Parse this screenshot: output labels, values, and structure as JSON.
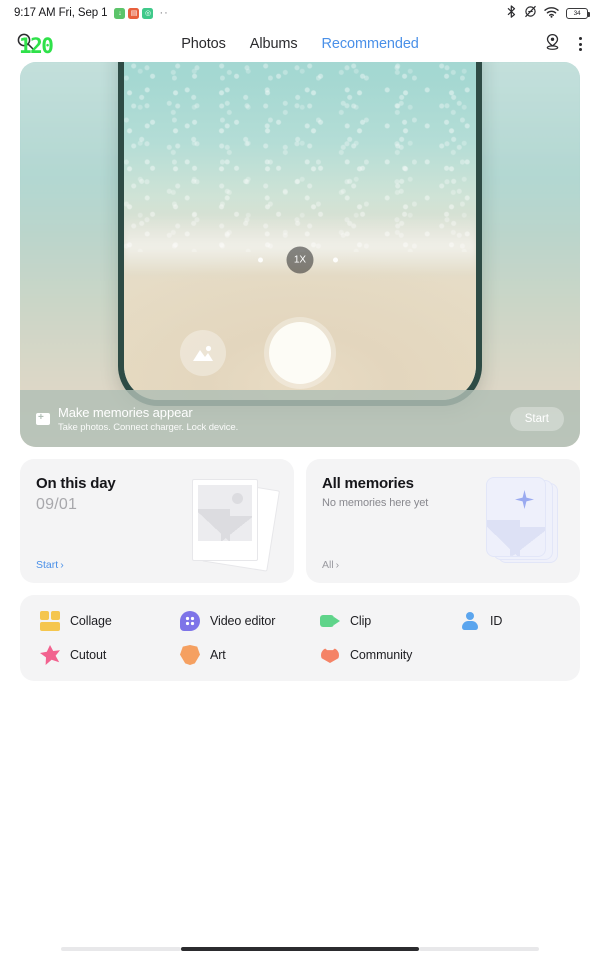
{
  "status_bar": {
    "time": "9:17 AM Fri, Sep 1",
    "app_icons": [
      {
        "name": "download-icon",
        "glyph": "↓",
        "color": "#5cc46a"
      },
      {
        "name": "notes-icon",
        "glyph": "▤",
        "color": "#e8603c"
      },
      {
        "name": "chat-icon",
        "glyph": "◎",
        "color": "#3fc98a"
      }
    ],
    "overflow_dots": "··",
    "bluetooth_icon": "bluetooth-icon",
    "dnd_icon": "do-not-disturb-icon",
    "wifi_icon": "wifi-icon",
    "battery_level": "34"
  },
  "header": {
    "search_icon": "search-icon",
    "fps_badge": "120",
    "tabs": [
      {
        "label": "Photos",
        "active": false
      },
      {
        "label": "Albums",
        "active": false
      },
      {
        "label": "Recommended",
        "active": true
      }
    ],
    "location_icon": "location-pin-icon",
    "more_icon": "more-vertical-icon"
  },
  "hero": {
    "camera_zoom_label": "1X",
    "gallery_icon": "gallery-thumbnail-icon",
    "shutter_icon": "shutter-button-icon",
    "flip_icon": "camera-flip-icon",
    "caption_icon": "add-photo-icon",
    "caption_title": "Make memories appear",
    "caption_subtitle": "Take photos. Connect charger. Lock device.",
    "start_button": "Start"
  },
  "memory_cards": [
    {
      "title": "On this day",
      "subtitle": "09/01",
      "link": "Start",
      "link_chevron": "›",
      "illustration": "polaroid-stack-icon"
    },
    {
      "title": "All memories",
      "subtitle": "No memories here yet",
      "link": "All",
      "link_chevron": "›",
      "illustration": "sparkle-card-icon"
    }
  ],
  "tools": [
    {
      "label": "Collage",
      "icon": "collage-icon",
      "color": "#f5c64e"
    },
    {
      "label": "Video editor",
      "icon": "video-editor-icon",
      "color": "#7e74e8"
    },
    {
      "label": "Clip",
      "icon": "clip-icon",
      "color": "#5fd48a"
    },
    {
      "label": "ID",
      "icon": "id-icon",
      "color": "#5ba5ee"
    },
    {
      "label": "Cutout",
      "icon": "cutout-icon",
      "color": "#f2628f"
    },
    {
      "label": "Art",
      "icon": "art-icon",
      "color": "#f5a061"
    },
    {
      "label": "Community",
      "icon": "community-icon",
      "color": "#f58366"
    }
  ],
  "nav_bar": {
    "handle_icon": "gesture-handle-icon"
  },
  "colors": {
    "accent_blue": "#4a90e8",
    "card_bg": "#f4f4f5",
    "fps_green": "#2fe14a",
    "phone_frame": "#2e4b45"
  }
}
